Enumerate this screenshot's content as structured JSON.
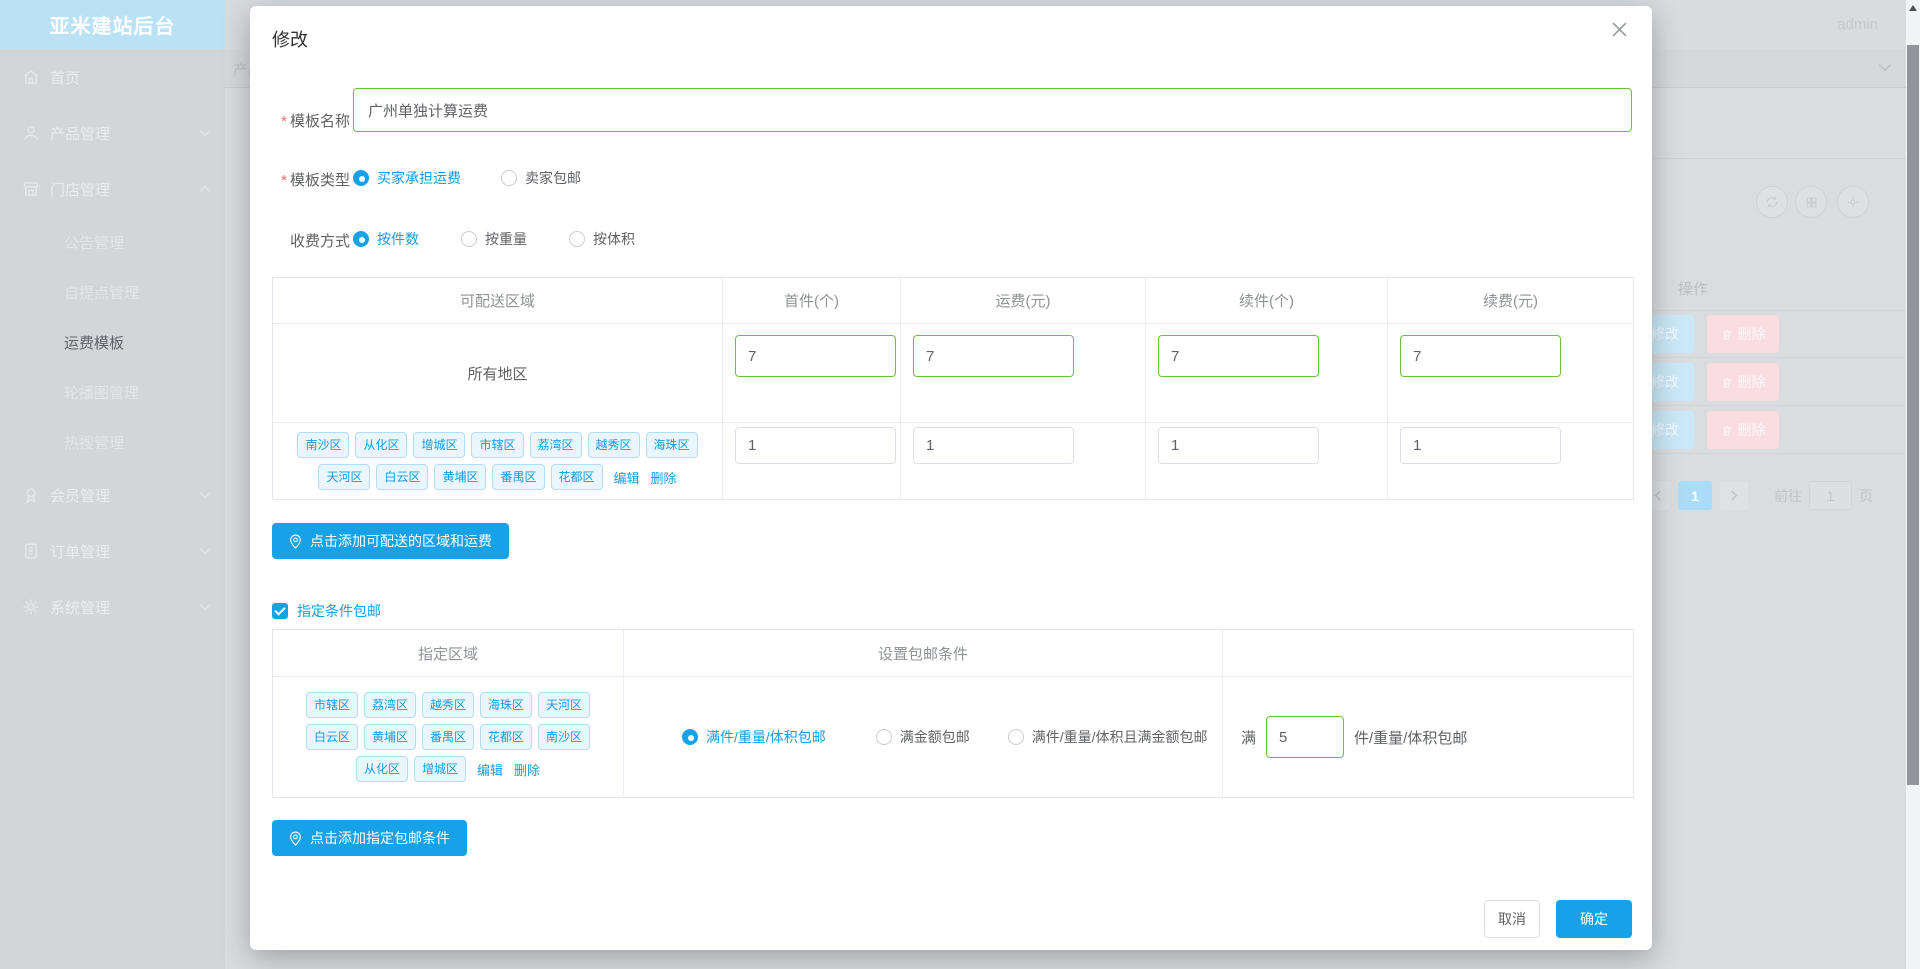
{
  "app": {
    "brand": "亚米建站后台",
    "user": "admin",
    "ghost_breadcrumb": "产品管理"
  },
  "sidebar": {
    "menu": [
      {
        "label": "首页"
      },
      {
        "label": "产品管理"
      },
      {
        "label": "门店管理"
      },
      {
        "label": "会员管理"
      },
      {
        "label": "订单管理"
      },
      {
        "label": "系统管理"
      }
    ],
    "store_submenu": [
      "公告管理",
      "自提点管理",
      "运费模板",
      "轮播图管理",
      "热搜管理"
    ],
    "active_item": "运费模板"
  },
  "modal": {
    "title": "修改",
    "required_mark": "*",
    "name_label": "模板名称",
    "name_value": "广州单独计算运费",
    "type_label": "模板类型",
    "type_options": [
      "买家承担运费",
      "卖家包邮"
    ],
    "type_selected": "买家承担运费",
    "charge_label": "收费方式",
    "charge_options": [
      "按件数",
      "按重量",
      "按体积"
    ],
    "charge_selected": "按件数",
    "shipping_table": {
      "headers": [
        "可配送区域",
        "首件(个)",
        "运费(元)",
        "续件(个)",
        "续费(元)"
      ],
      "all_region_label": "所有地区",
      "all_region_values": [
        "7",
        "7",
        "7",
        "7"
      ],
      "custom_tags_line1": [
        "南沙区",
        "从化区",
        "增城区",
        "市辖区",
        "荔湾区",
        "越秀区",
        "海珠区"
      ],
      "custom_tags_line2": [
        "天河区",
        "白云区",
        "黄埔区",
        "番禺区",
        "花都区"
      ],
      "custom_values": [
        "1",
        "1",
        "1",
        "1"
      ],
      "edit_link": "编辑",
      "delete_link": "删除"
    },
    "add_region_button": "点击添加可配送的区域和运费",
    "conditional_label": "指定条件包邮",
    "conditional_checked": true,
    "free_shipping": {
      "headers": [
        "指定区域",
        "设置包邮条件"
      ],
      "tags_line1": [
        "市辖区",
        "荔湾区",
        "越秀区",
        "海珠区",
        "天河区"
      ],
      "tags_line2": [
        "白云区",
        "黄埔区",
        "番禺区",
        "花都区",
        "南沙区"
      ],
      "tags_line3": [
        "从化区",
        "增城区"
      ],
      "edit_link": "编辑",
      "delete_link": "删除",
      "options": [
        "满件/重量/体积包邮",
        "满金额包邮",
        "满件/重量/体积且满金额包邮"
      ],
      "selected_option": "满件/重量/体积包邮",
      "threshold_prefix": "满",
      "threshold_value": "5",
      "threshold_suffix": "件/重量/体积包邮"
    },
    "add_condition_button": "点击添加指定包邮条件",
    "cancel_label": "取消",
    "confirm_label": "确定"
  },
  "background": {
    "action_header": "操作",
    "modify_label": "修改",
    "delete_label": "删除",
    "pagination": {
      "current": "1",
      "goto_label": "前往",
      "goto_value": "1",
      "unit_label": "页"
    }
  },
  "colors": {
    "primary_blue": "#17a2e8",
    "link_blue": "#149ce4",
    "success_green": "#67c23a",
    "tag_bg": "#eaf6fd",
    "tag_border": "#b3dcf5",
    "danger_red": "#f56c6c",
    "brand_header_bg": "#bae2f4"
  }
}
